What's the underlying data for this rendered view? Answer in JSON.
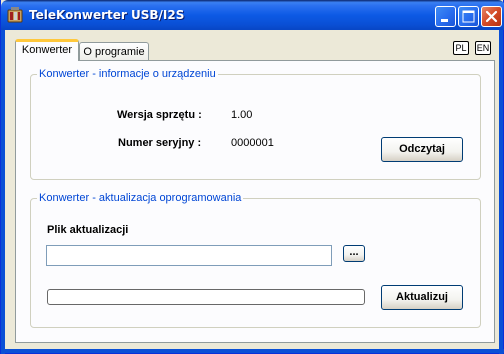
{
  "window": {
    "title": "TeleKonwerter USB/I2S",
    "title_bar_color": "#0a50d6",
    "controls": [
      "minimize-icon",
      "maximize-icon",
      "close-icon"
    ]
  },
  "tabs": [
    {
      "label": "Konwerter",
      "active": true
    },
    {
      "label": "O programie",
      "active": false
    }
  ],
  "language": {
    "pl_label": "PL",
    "en_label": "EN"
  },
  "device_info": {
    "group_title": "Konwerter - informacje o urządzeniu",
    "hw_version_label": "Wersja sprzętu :",
    "hw_version_value": "1.00",
    "serial_label": "Numer seryjny :",
    "serial_value": "0000001",
    "read_button": "Odczytaj"
  },
  "firmware_update": {
    "group_title": "Konwerter - aktualizacja oprogramowania",
    "file_label": "Plik aktualizacji",
    "file_value": "",
    "browse_button": "...",
    "progress": 0,
    "update_button": "Aktualizuj"
  },
  "colors": {
    "accent_blue": "#0046d5",
    "tab_highlight": "#ffc83c",
    "window_bg": "#ece9d8"
  }
}
